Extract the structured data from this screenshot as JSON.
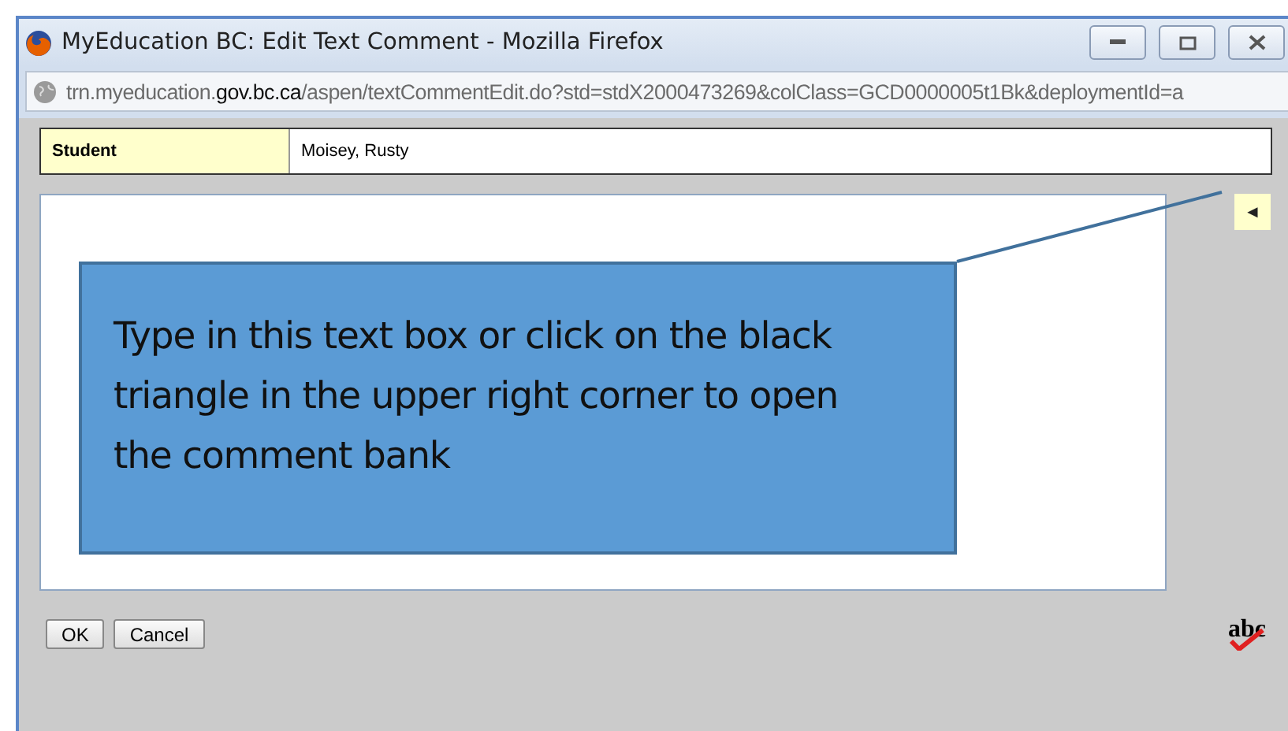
{
  "window": {
    "title": "MyEducation BC: Edit Text Comment - Mozilla Firefox"
  },
  "address_bar": {
    "prefix": "trn.myeducation.",
    "domain": "gov.bc.ca",
    "path": "/aspen/textCommentEdit.do?std=stdX2000473269&colClass=GCD0000005t1Bk&deploymentId=a"
  },
  "student": {
    "label": "Student",
    "value": "Moisey, Rusty"
  },
  "comment_bank_toggle": {
    "symbol": "◄"
  },
  "callout": {
    "text": "Type in this text box or click on the black triangle in the upper right corner to open the comment bank"
  },
  "buttons": [
    "OK",
    "Cancel"
  ],
  "spell_check": {
    "label": "abc"
  }
}
